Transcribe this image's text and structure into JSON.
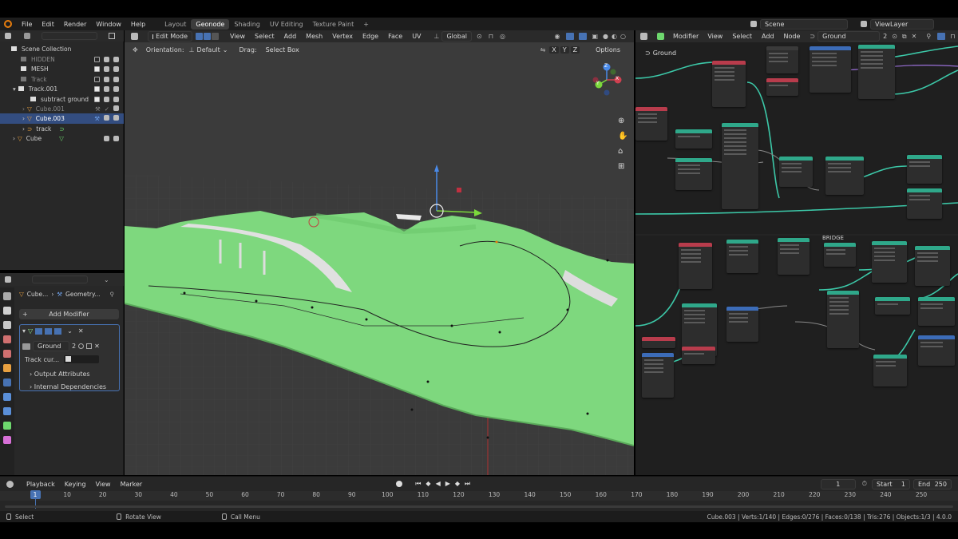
{
  "menu": {
    "items": [
      "File",
      "Edit",
      "Render",
      "Window",
      "Help"
    ],
    "workspaces": [
      "Layout",
      "Geonode",
      "Shading",
      "UV Editing",
      "Texture Paint"
    ],
    "active_workspace": "Geonode",
    "add_tab": "+",
    "scene": "Scene",
    "view_layer": "ViewLayer"
  },
  "outliner": {
    "root": "Scene Collection",
    "rows": [
      {
        "label": "HIDDEN",
        "dim": true
      },
      {
        "label": "MESH",
        "dim": false
      },
      {
        "label": "Track",
        "dim": true
      },
      {
        "label": "Track.001",
        "dim": false
      },
      {
        "label": "subtract ground",
        "dim": false
      },
      {
        "label": "Cube.001",
        "dim": true
      },
      {
        "label": "Cube.003",
        "dim": false,
        "selected": true
      },
      {
        "label": "track",
        "dim": false
      },
      {
        "label": "Cube",
        "dim": false
      }
    ]
  },
  "properties": {
    "breadcrumb_object": "Cube...",
    "breadcrumb_modifier": "Geometry...",
    "add_modifier": "Add Modifier",
    "node_group": "Ground",
    "node_group_users": "2",
    "track_curve_label": "Track cur...",
    "sections": [
      "Output Attributes",
      "Internal Dependencies"
    ]
  },
  "viewport": {
    "mode": "Edit Mode",
    "menus": [
      "View",
      "Select",
      "Add",
      "Mesh",
      "Vertex",
      "Edge",
      "Face",
      "UV"
    ],
    "transform_orientation": "Global",
    "orientation_label": "Orientation:",
    "orientation_value": "Default",
    "drag_label": "Drag:",
    "drag_value": "Select Box",
    "axes": [
      "X",
      "Y",
      "Z"
    ],
    "options": "Options",
    "gizmo": {
      "x": "X",
      "y": "Y",
      "z": "Z"
    },
    "colors": {
      "ground": "#7ed87e",
      "ground_dark": "#5fbf5f",
      "bg": "#3a3a3a"
    }
  },
  "node_editor": {
    "editor": "Modifier",
    "menus": [
      "View",
      "Select",
      "Add",
      "Node"
    ],
    "node_group": "Ground",
    "users": "2",
    "breadcrumb": "Ground",
    "frame_label": "BRIDGE"
  },
  "timeline": {
    "menus": [
      "Playback",
      "Keying",
      "View",
      "Marker"
    ],
    "current_frame": "1",
    "start_label": "Start",
    "start": "1",
    "end_label": "End",
    "end": "250",
    "ticks": [
      "1",
      "10",
      "20",
      "30",
      "40",
      "50",
      "60",
      "70",
      "80",
      "90",
      "100",
      "110",
      "120",
      "130",
      "140",
      "150",
      "160",
      "170",
      "180",
      "190",
      "200",
      "210",
      "220",
      "230",
      "240",
      "250"
    ]
  },
  "status": {
    "select": "Select",
    "rotate": "Rotate View",
    "call_menu": "Call Menu",
    "stats": "Cube.003 | Verts:1/140 | Edges:0/276 | Faces:0/138 | Tris:276 | Objects:1/3 | 4.0.0"
  }
}
